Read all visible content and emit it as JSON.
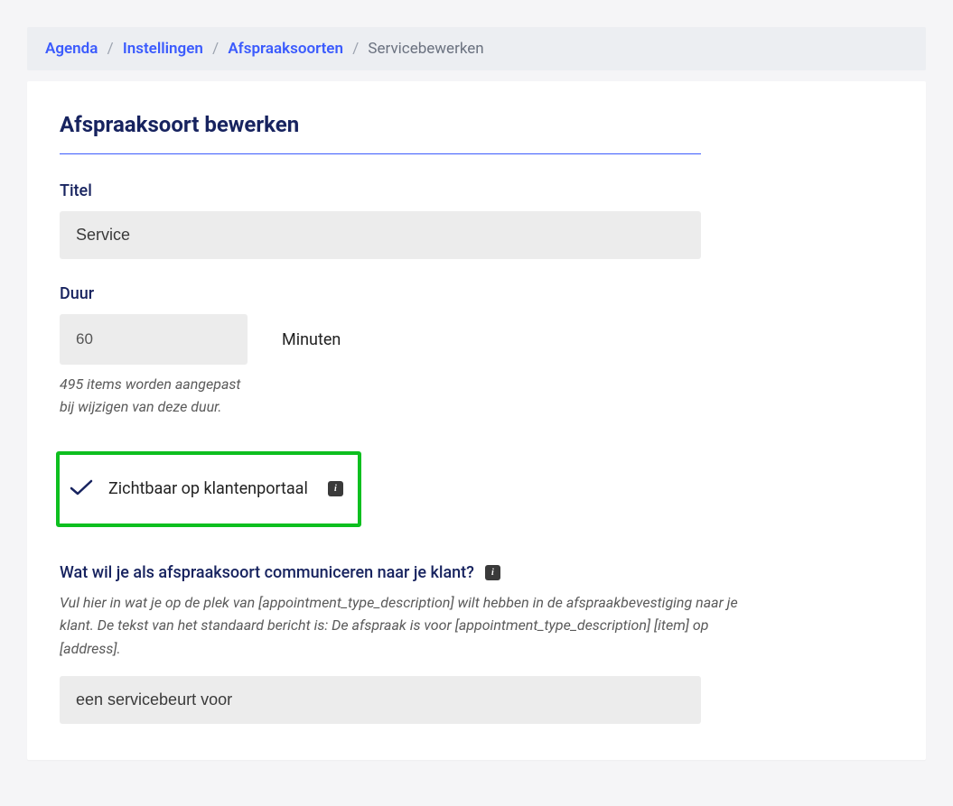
{
  "breadcrumb": {
    "items": [
      {
        "label": "Agenda",
        "link": true
      },
      {
        "label": "Instellingen",
        "link": true
      },
      {
        "label": "Afspraaksoorten",
        "link": true
      },
      {
        "label": "Servicebewerken",
        "link": false
      }
    ]
  },
  "page": {
    "title": "Afspraaksoort bewerken"
  },
  "fields": {
    "title_label": "Titel",
    "title_value": "Service",
    "duration_label": "Duur",
    "duration_value": "60",
    "duration_unit": "Minuten",
    "duration_hint": "495 items worden aangepast bij wijzigen van deze duur."
  },
  "visibility": {
    "label": "Zichtbaar op klantenportaal",
    "checked": true,
    "info_char": "i"
  },
  "communication": {
    "question": "Wat wil je als afspraaksoort communiceren naar je klant?",
    "info_char": "i",
    "help": "Vul hier in wat je op de plek van [appointment_type_description] wilt hebben in de afspraakbevestiging naar je klant. De tekst van het standaard bericht is: De afspraak is voor [appointment_type_description] [item] op [address].",
    "value": "een servicebeurt voor"
  }
}
